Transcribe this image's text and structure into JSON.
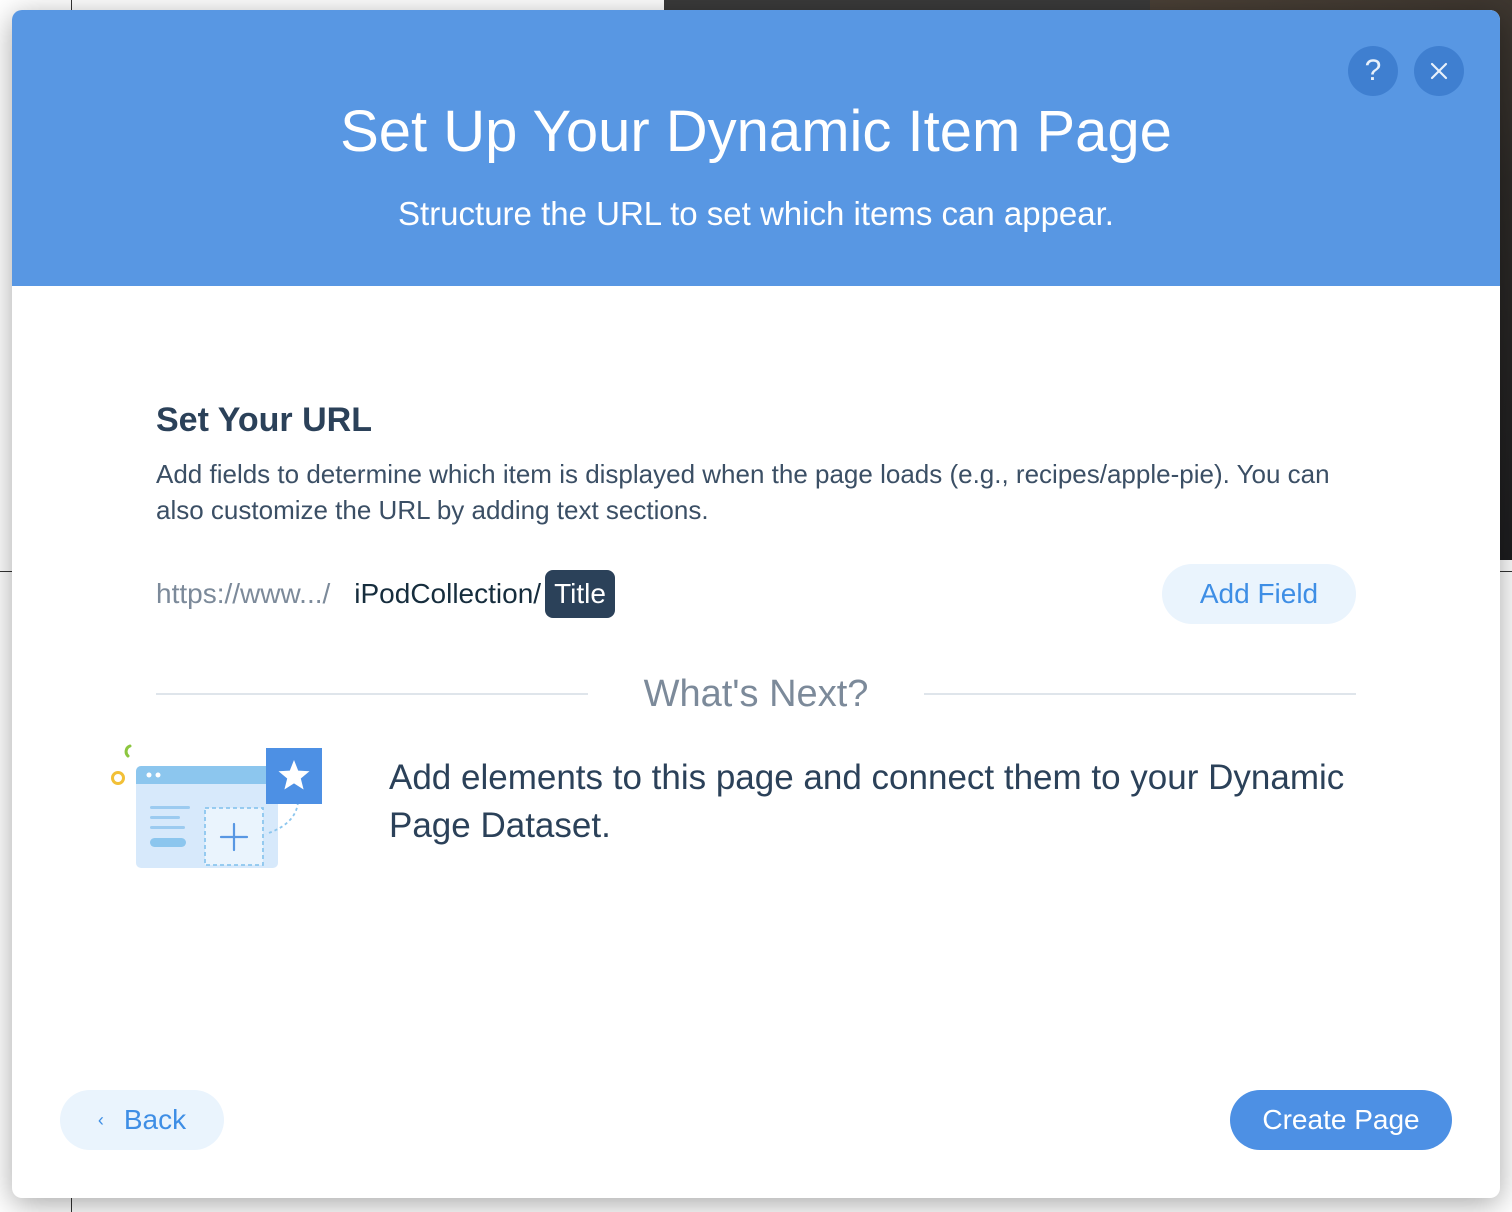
{
  "header": {
    "title": "Set Up Your Dynamic Item Page",
    "subtitle": "Structure the URL to set which items can appear.",
    "help_label": "?",
    "close_icon": "close-icon"
  },
  "url_section": {
    "title": "Set Your URL",
    "description": "Add fields to determine which item is displayed when the page loads (e.g., recipes/apple-pie). You can also customize the URL by adding text sections.",
    "prefix": "https://www.../",
    "collection": "iPodCollection/",
    "field": "Title",
    "add_field_label": "Add Field"
  },
  "whats_next": {
    "title": "What's Next?",
    "text": "Add elements to this page and connect them to your Dynamic Page Dataset.",
    "illustration_icon": "page-with-star-illustration"
  },
  "footer": {
    "back_label": "Back",
    "back_icon": "chevron-left-icon",
    "create_label": "Create Page"
  },
  "colors": {
    "header_bg": "#5897e3",
    "primary_button": "#4d90e4",
    "secondary_button": "#eaf4fd",
    "heading_text": "#2b4159",
    "chip_bg": "#2b4159"
  }
}
